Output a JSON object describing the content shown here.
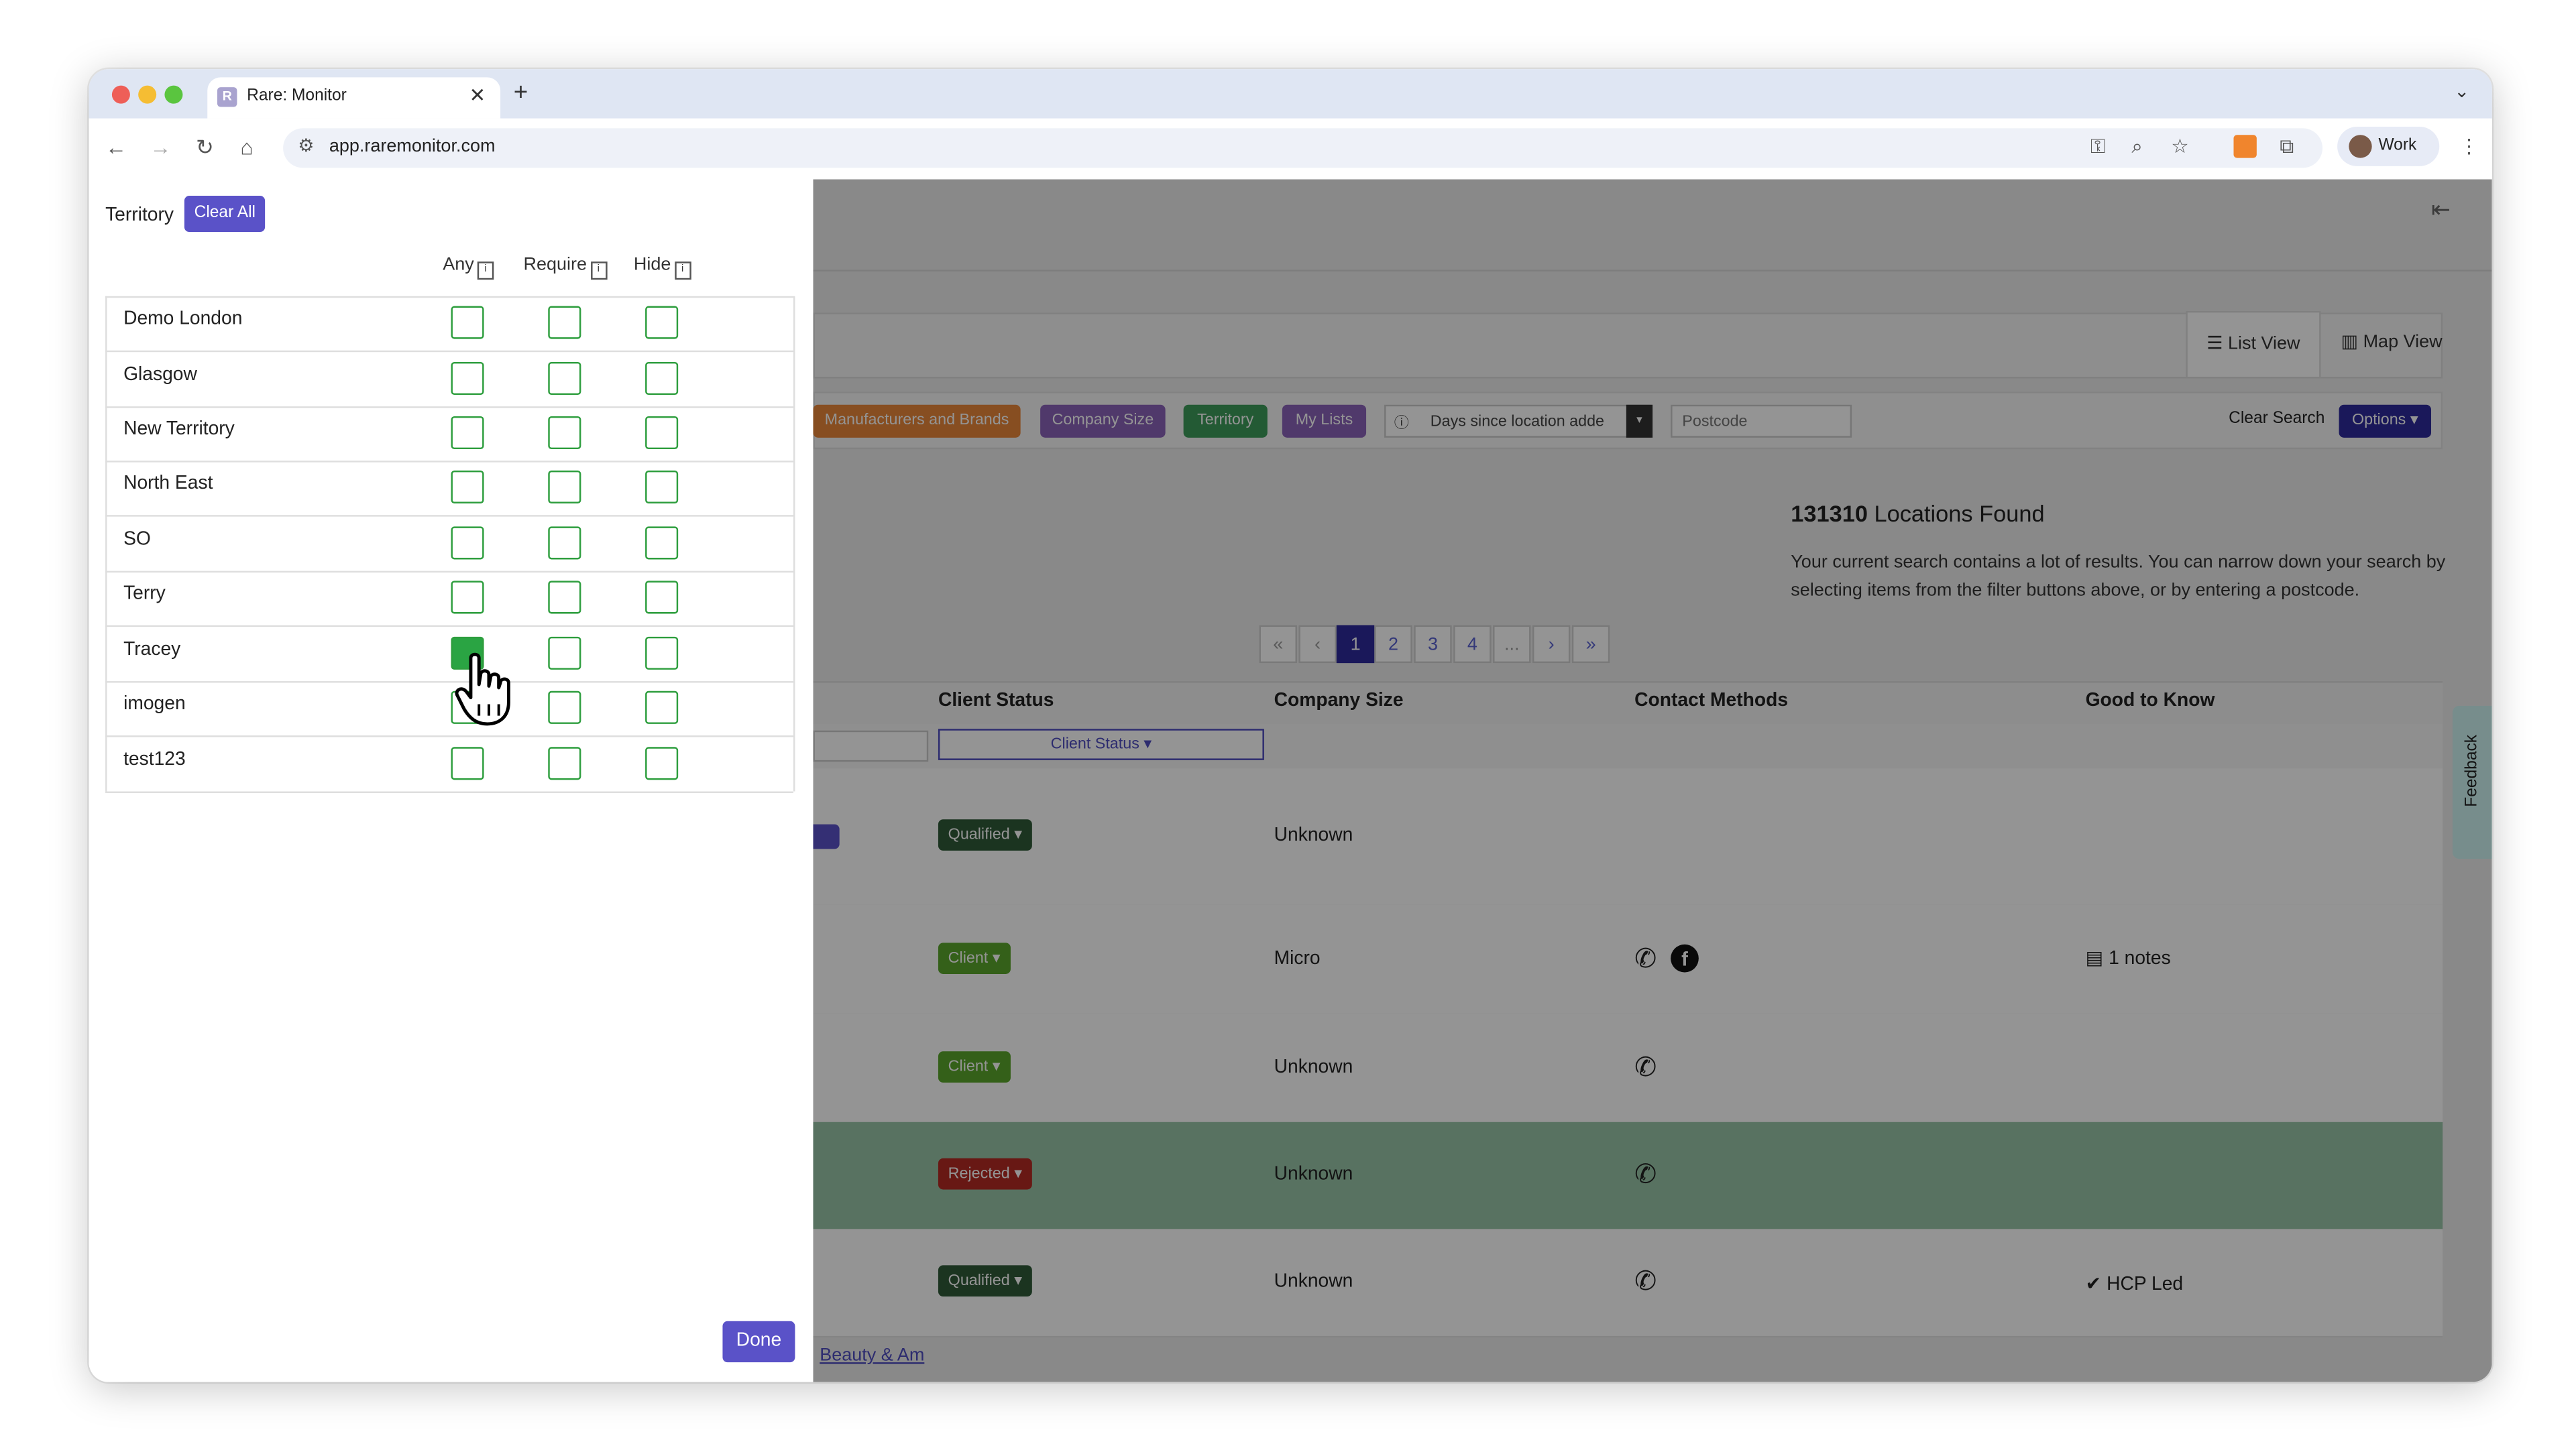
{
  "browser": {
    "tab_title": "Rare: Monitor",
    "tab_icon_letter": "R",
    "url": "app.raremonitor.com",
    "profile": "Work"
  },
  "filter_panel": {
    "title": "Territory",
    "clear_all_label": "Clear All",
    "columns": [
      "Any",
      "Require",
      "Hide"
    ],
    "rows": [
      {
        "label": "Demo London",
        "any": false,
        "require": false,
        "hide": false
      },
      {
        "label": "Glasgow",
        "any": false,
        "require": false,
        "hide": false
      },
      {
        "label": "New Territory",
        "any": false,
        "require": false,
        "hide": false
      },
      {
        "label": "North East",
        "any": false,
        "require": false,
        "hide": false
      },
      {
        "label": "SO",
        "any": false,
        "require": false,
        "hide": false
      },
      {
        "label": "Terry",
        "any": false,
        "require": false,
        "hide": false
      },
      {
        "label": "Tracey",
        "any": true,
        "require": false,
        "hide": false
      },
      {
        "label": "imogen",
        "any": false,
        "require": false,
        "hide": false
      },
      {
        "label": "test123",
        "any": false,
        "require": false,
        "hide": false
      }
    ],
    "done_label": "Done"
  },
  "view_toggle": {
    "list": "List View",
    "map": "Map View"
  },
  "filters": {
    "manufacturers": "Manufacturers and Brands",
    "company_size": "Company Size",
    "territory": "Territory",
    "my_lists": "My Lists",
    "days_since": "Days since location adde",
    "postcode_placeholder": "Postcode",
    "clear_search": "Clear Search",
    "options": "Options"
  },
  "results": {
    "count": "131310",
    "found_label": "Locations Found",
    "message": "Your current search contains a lot of results. You can narrow down your search by selecting items from the filter buttons above, or by entering a postcode."
  },
  "pagination": {
    "first": "«",
    "prev": "‹",
    "pages": [
      "1",
      "2",
      "3",
      "4",
      "..."
    ],
    "next": "›",
    "last": "»",
    "active": "1"
  },
  "table": {
    "headers": {
      "client_status": "Client Status",
      "company_size": "Company Size",
      "contact_methods": "Contact Methods",
      "good_to_know": "Good to Know"
    },
    "client_status_filter": "Client Status",
    "rows": [
      {
        "status": "Qualified",
        "status_color": "#2f5a38",
        "size": "Unknown",
        "phone": false,
        "facebook": false,
        "good_to_know": ""
      },
      {
        "status": "Client",
        "status_color": "#5aa62c",
        "size": "Micro",
        "phone": true,
        "facebook": true,
        "good_to_know": "1 notes"
      },
      {
        "status": "Client",
        "status_color": "#5aa62c",
        "size": "Unknown",
        "phone": true,
        "facebook": false,
        "good_to_know": ""
      },
      {
        "status": "Rejected",
        "status_color": "#b42a24",
        "size": "Unknown",
        "phone": true,
        "facebook": false,
        "good_to_know": ""
      },
      {
        "status": "Qualified",
        "status_color": "#2f5a38",
        "size": "Unknown",
        "phone": true,
        "facebook": false,
        "good_to_know": "HCP Led"
      }
    ],
    "bottom_link": "Beauty & Am"
  },
  "feedback_tab": "Feedback",
  "colors": {
    "accent": "#5a52c8",
    "checkbox_green": "#2aa443",
    "rejected_row": "#98c5a8"
  }
}
